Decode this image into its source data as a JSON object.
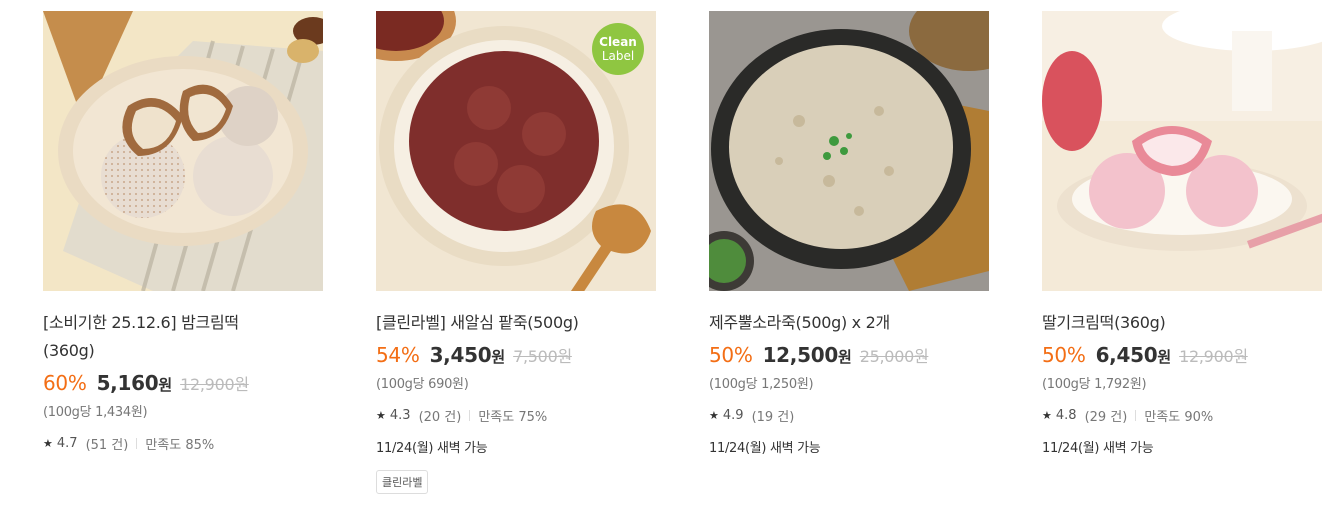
{
  "products": [
    {
      "title": "[소비기한 25.12.6] 밤크림떡 (360g)",
      "discount": "60%",
      "price": "5,160",
      "price_unit": "원",
      "original_price": "12,900원",
      "unit_price": "(100g당 1,434원)",
      "rating": "4.7",
      "review_count": "(51 건)",
      "satisfaction": "만족도 85%",
      "delivery": ""
    },
    {
      "title": "[클린라벨] 새알심 팥죽(500g)",
      "discount": "54%",
      "price": "3,450",
      "price_unit": "원",
      "original_price": "7,500원",
      "unit_price": "(100g당 690원)",
      "rating": "4.3",
      "review_count": "(20 건)",
      "satisfaction": "만족도 75%",
      "delivery": "11/24(월) 새벽 가능",
      "tag": "클린라벨",
      "badge_line1": "Clean",
      "badge_line2": "Label"
    },
    {
      "title": "제주뿔소라죽(500g) x 2개",
      "discount": "50%",
      "price": "12,500",
      "price_unit": "원",
      "original_price": "25,000원",
      "unit_price": "(100g당 1,250원)",
      "rating": "4.9",
      "review_count": "(19 건)",
      "satisfaction": "",
      "delivery": "11/24(월) 새벽 가능"
    },
    {
      "title": "딸기크림떡(360g)",
      "discount": "50%",
      "price": "6,450",
      "price_unit": "원",
      "original_price": "12,900원",
      "unit_price": "(100g당 1,792원)",
      "rating": "4.8",
      "review_count": "(29 건)",
      "satisfaction": "만족도 90%",
      "delivery": "11/24(월) 새벽 가능"
    }
  ],
  "colors": {
    "discount": "#f36e15",
    "strike": "#bbbbbb",
    "badge": "#8fc641"
  },
  "icons": {
    "rating": "star-icon"
  }
}
